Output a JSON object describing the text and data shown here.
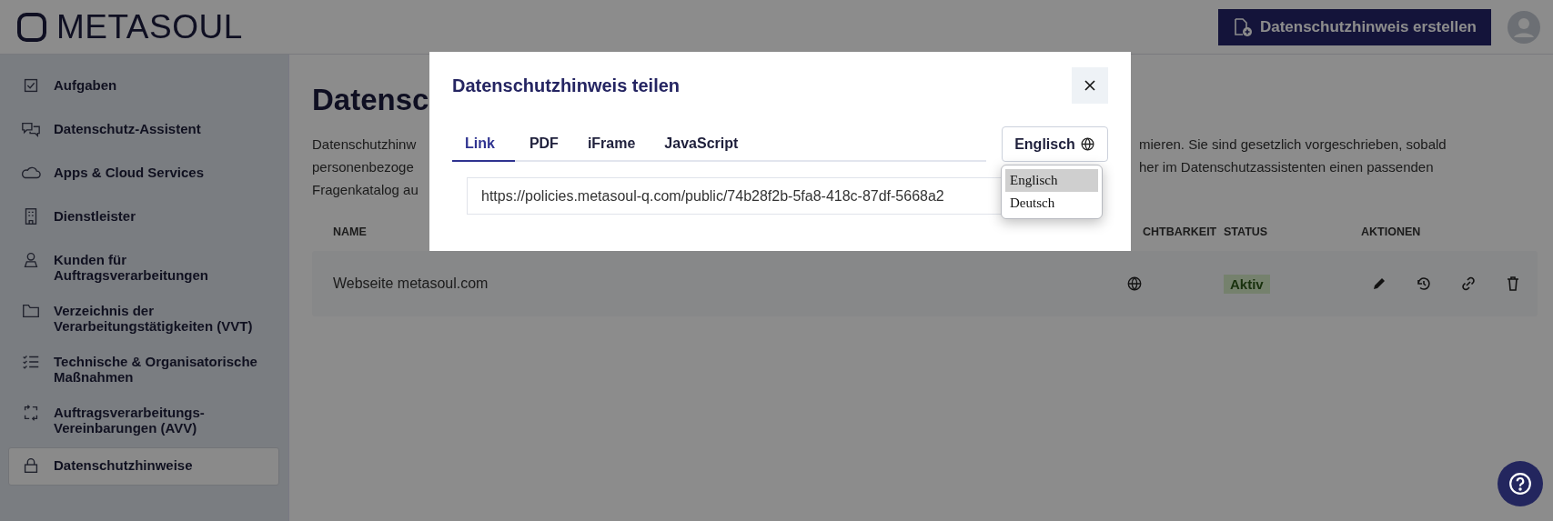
{
  "header": {
    "logo": "METASOUL",
    "create_button": "Datenschutzhinweis erstellen"
  },
  "sidebar": {
    "items": [
      {
        "label": "Aufgaben",
        "selected": false
      },
      {
        "label": "Datenschutz-Assistent",
        "selected": false
      },
      {
        "label": "Apps & Cloud Services",
        "selected": false
      },
      {
        "label": "Dienstleister",
        "selected": false
      },
      {
        "label": "Kunden für Auftragsverarbeitungen",
        "selected": false
      },
      {
        "label": "Verzeichnis der Verarbeitungstätigkeiten (VVT)",
        "selected": false
      },
      {
        "label": "Technische & Organisatorische Maßnahmen",
        "selected": false
      },
      {
        "label": "Auftragsverarbeitungs-Vereinbarungen (AVV)",
        "selected": false
      },
      {
        "label": "Datenschutzhinweise",
        "selected": true
      }
    ]
  },
  "page": {
    "title": "Datensc",
    "description_lines": [
      {
        "left": "Datenschutzhinw",
        "right": "mieren. Sie sind gesetzlich vorgeschrieben, sobald"
      },
      {
        "left": "personenbezoge",
        "right": "her im Datenschutzassistenten einen passenden"
      },
      {
        "left": "Fragenkatalog au"
      }
    ]
  },
  "table": {
    "columns": [
      {
        "label": "NAME"
      },
      {
        "label": "CHTBARKEIT"
      },
      {
        "label": "STATUS"
      },
      {
        "label": "AKTIONEN"
      }
    ],
    "rows": [
      {
        "name": "Webseite metasoul.com",
        "status": "Aktiv"
      }
    ]
  },
  "modal": {
    "title": "Datenschutzhinweis teilen",
    "tabs": [
      {
        "label": "Link",
        "selected": true
      },
      {
        "label": "PDF",
        "selected": false
      },
      {
        "label": "iFrame",
        "selected": false
      },
      {
        "label": "JavaScript",
        "selected": false
      }
    ],
    "language_button": "Englisch",
    "language_options": [
      {
        "label": "Englisch",
        "selected": true
      },
      {
        "label": "Deutsch",
        "selected": false
      }
    ],
    "url": "https://policies.metasoul-q.com/public/74b28f2b-5fa8-418c-87df-5668a2"
  }
}
